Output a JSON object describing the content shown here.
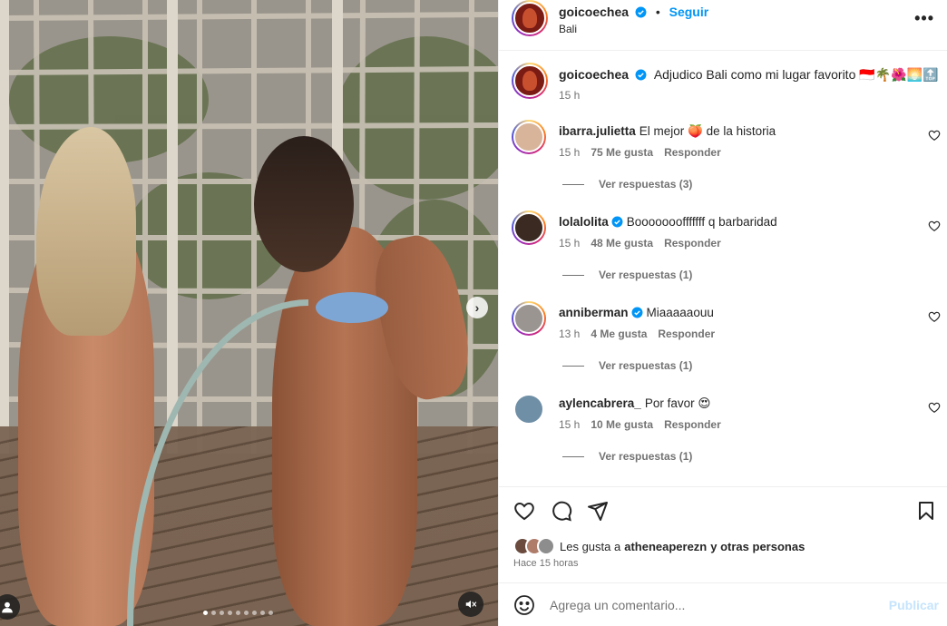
{
  "post": {
    "username": "goicoechea",
    "follow_label": "Seguir",
    "location": "Bali",
    "caption": "Adjudico Bali como mi lugar favorito 🇮🇩🌴🌺🌅🔝",
    "caption_time": "15 h",
    "media": {
      "slide_count": 9,
      "active_slide": 1
    }
  },
  "comments": [
    {
      "username": "ibarra.julietta",
      "verified": false,
      "text": "El mejor 🍑 de la historia",
      "time": "15 h",
      "likes": "75 Me gusta",
      "reply_label": "Responder",
      "replies": "Ver respuestas (3)",
      "avatar_color": "#d8b59a",
      "ring": true
    },
    {
      "username": "lolalolita",
      "verified": true,
      "text": "Booooooofffffff q barbaridad",
      "time": "15 h",
      "likes": "48 Me gusta",
      "reply_label": "Responder",
      "replies": "Ver respuestas (1)",
      "avatar_color": "#3a2a22",
      "ring": true
    },
    {
      "username": "anniberman",
      "verified": true,
      "text": "Miaaaaaouu",
      "time": "13 h",
      "likes": "4 Me gusta",
      "reply_label": "Responder",
      "replies": "Ver respuestas (1)",
      "avatar_color": "#9a9590",
      "ring": true
    },
    {
      "username": "aylencabrera_",
      "verified": false,
      "text": "Por favor 😍",
      "time": "15 h",
      "likes": "10 Me gusta",
      "reply_label": "Responder",
      "replies": "Ver respuestas (1)",
      "avatar_color": "#6f8fa6",
      "ring": false
    }
  ],
  "likes": {
    "prefix": "Les gusta a",
    "user": "atheneaperezn",
    "suffix": "y otras personas",
    "liker_colors": [
      "#6b4b3e",
      "#b07c6a",
      "#8d8d8d"
    ]
  },
  "time_ago": "Hace 15 horas",
  "add_comment": {
    "placeholder": "Agrega un comentario...",
    "publish_label": "Publicar"
  },
  "colors": {
    "accent": "#0095f6",
    "verified": "#0095f6",
    "muted": "#737373"
  }
}
